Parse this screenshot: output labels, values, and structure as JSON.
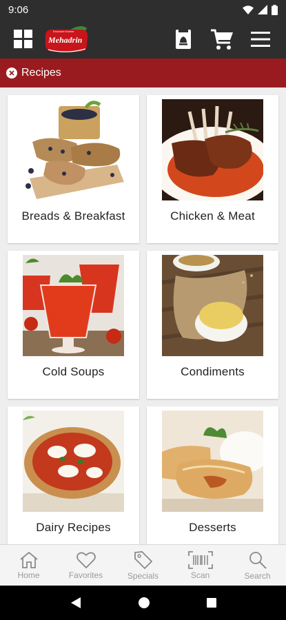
{
  "status_bar": {
    "time": "9:06"
  },
  "app": {
    "logo_text": "Mehadrin",
    "logo_tagline": "Exclusive Kosher"
  },
  "breadcrumb": {
    "label": "Recipes"
  },
  "categories": [
    {
      "label": "Breads & Breakfast"
    },
    {
      "label": "Chicken & Meat"
    },
    {
      "label": "Cold Soups"
    },
    {
      "label": "Condiments"
    },
    {
      "label": "Dairy Recipes"
    },
    {
      "label": "Desserts"
    }
  ],
  "bottom_nav": [
    {
      "label": "Home",
      "icon": "home-icon"
    },
    {
      "label": "Favorites",
      "icon": "heart-icon"
    },
    {
      "label": "Specials",
      "icon": "tag-icon"
    },
    {
      "label": "Scan",
      "icon": "barcode-icon"
    },
    {
      "label": "Search",
      "icon": "search-icon"
    }
  ],
  "colors": {
    "app_bar": "#2e2e2e",
    "accent": "#9a1b1f",
    "nav_text": "#9a9a9a"
  }
}
